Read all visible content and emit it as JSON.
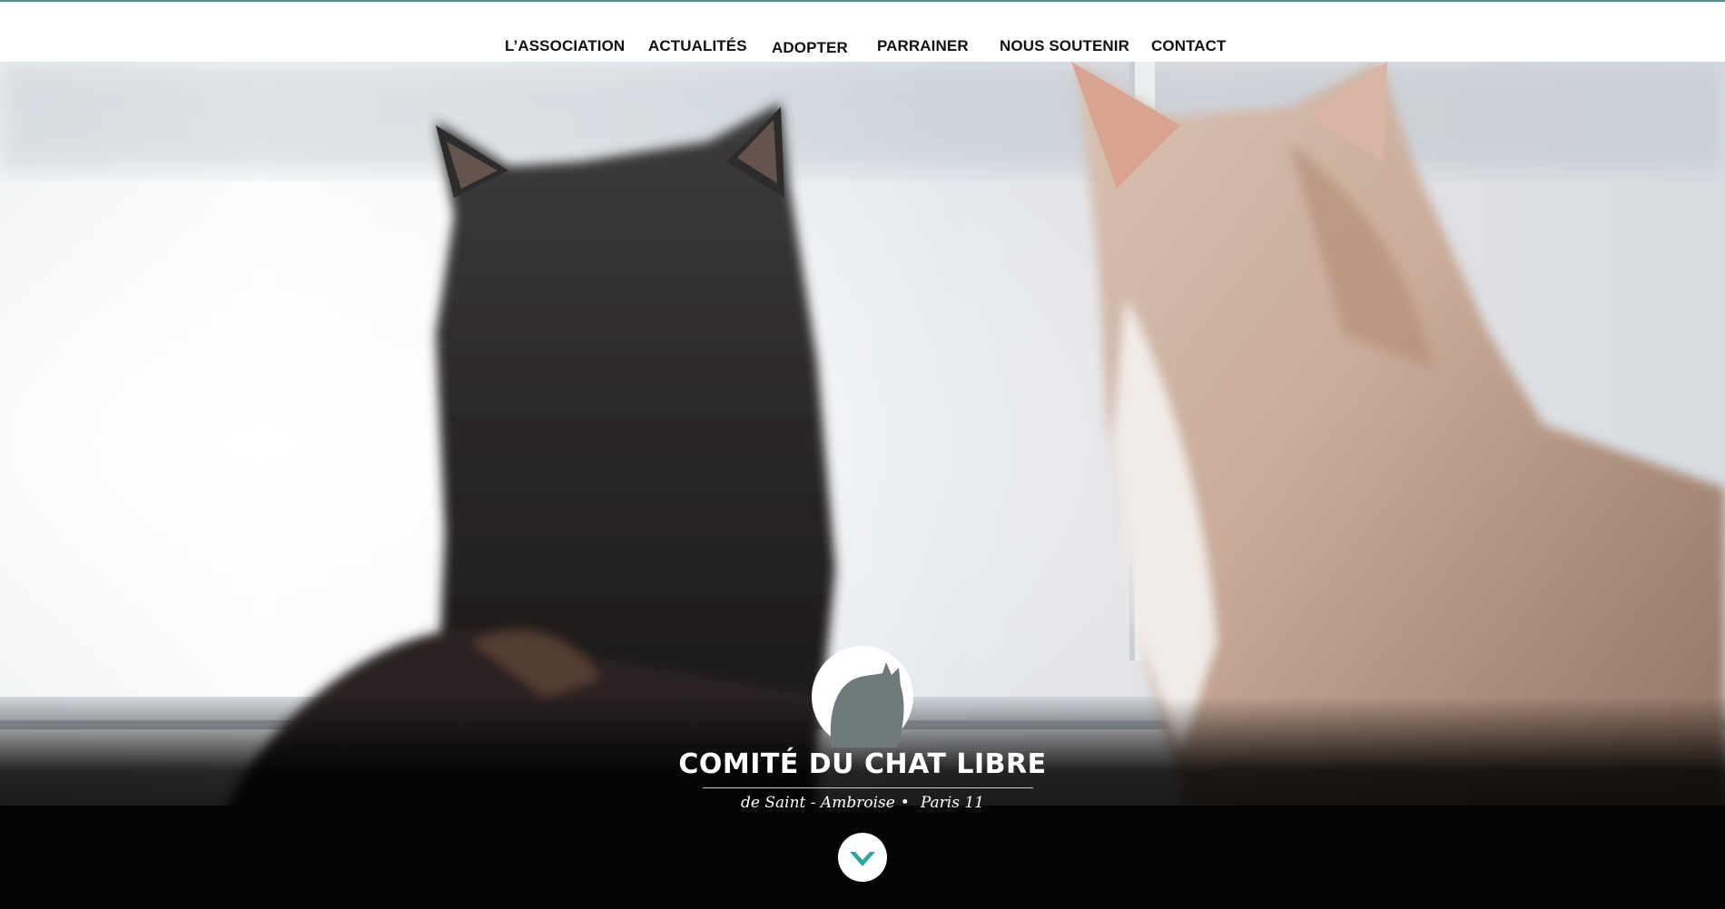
{
  "nav": {
    "items": [
      {
        "label": "L’ASSOCIATION"
      },
      {
        "label": "ACTUALITÉS"
      },
      {
        "label": "ADOPTER"
      },
      {
        "label": "PARRAINER"
      },
      {
        "label": "NOUS SOUTENIR"
      },
      {
        "label": "CONTACT"
      }
    ]
  },
  "hero": {
    "logo_title": "COMITÉ DU CHAT LIBRE",
    "subtitle_left": "de Saint - Ambroise",
    "subtitle_dot": "•",
    "subtitle_right": "Paris 11"
  },
  "icons": {
    "logo": "cat-silhouette-icon",
    "scroll": "chevron-down-icon"
  },
  "colors": {
    "accent": "#2aa8a0",
    "nav_text": "#111111",
    "top_strip": "#5a8c87"
  }
}
